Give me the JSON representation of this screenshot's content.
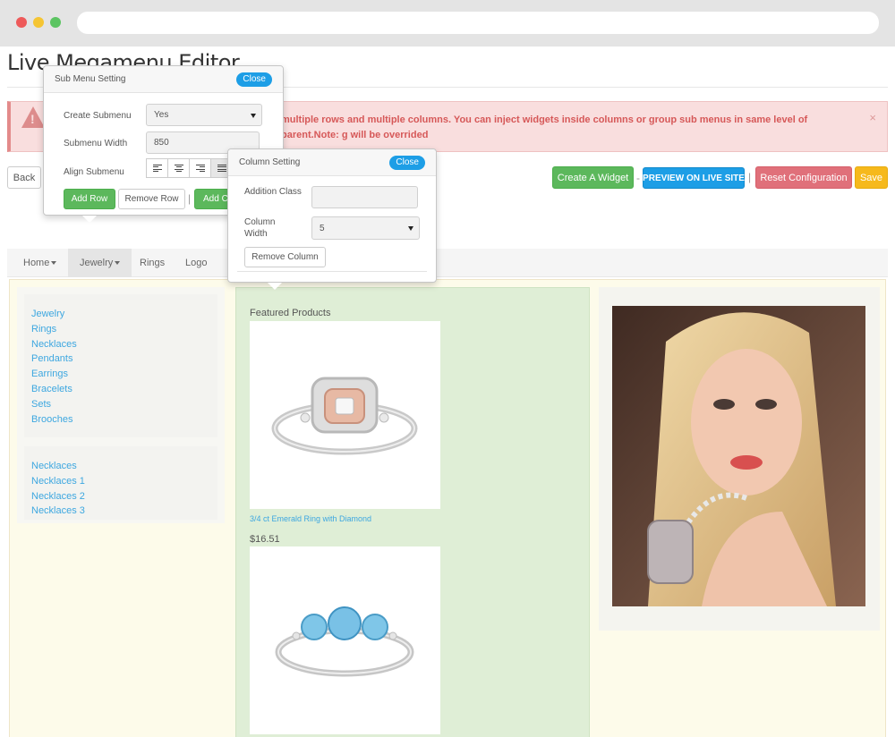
{
  "page": {
    "title": "Live Megamenu Editor"
  },
  "alert": {
    "text": "multiple rows and multiple columns. You can inject widgets inside columns or group sub menus in same level of parent.Note: g will be overrided",
    "close": "×"
  },
  "toolbar": {
    "back": "Back",
    "create_widget": "Create A Widget",
    "sep1": "-",
    "preview": "PREVIEW ON LIVE SITE",
    "sep2": "|",
    "reset": "Reset Configuration",
    "save": "Save"
  },
  "nav": {
    "items": [
      {
        "label": "Home"
      },
      {
        "label": "Jewelry"
      },
      {
        "label": "Rings"
      },
      {
        "label": "Logo"
      }
    ]
  },
  "megamenu": {
    "links1": [
      "Jewelry",
      "Rings",
      "Necklaces",
      "Pendants",
      "Earrings",
      "Bracelets",
      "Sets",
      "Brooches"
    ],
    "links2": [
      "Necklaces",
      "Necklaces 1",
      "Necklaces 2",
      "Necklaces 3"
    ],
    "featured_title": "Featured Products",
    "product1": {
      "name": "3/4 ct Emerald Ring with Diamond",
      "price": "$16.51"
    }
  },
  "submenu_setting": {
    "title": "Sub Menu Setting",
    "close": "Close",
    "create_label": "Create Submenu",
    "create_value": "Yes",
    "width_label": "Submenu Width",
    "width_value": "850",
    "align_label": "Align Submenu",
    "add_row": "Add Row",
    "remove_row": "Remove Row",
    "sep": "|",
    "add_col": "Add Co"
  },
  "column_setting": {
    "title": "Column Setting",
    "close": "Close",
    "class_label": "Addition Class",
    "class_value": "",
    "width_label": "Column Width",
    "width_value": "5",
    "remove_col": "Remove Column"
  },
  "colors": {
    "accent": "#1d9ee6",
    "green": "#5cb85c",
    "red": "#e0707a",
    "orange": "#f6b91c",
    "link": "#3da7e0"
  },
  "icons": {
    "alert": "warning-icon",
    "align": [
      "align-left-icon",
      "align-center-icon",
      "align-right-icon",
      "align-justify-icon"
    ]
  }
}
